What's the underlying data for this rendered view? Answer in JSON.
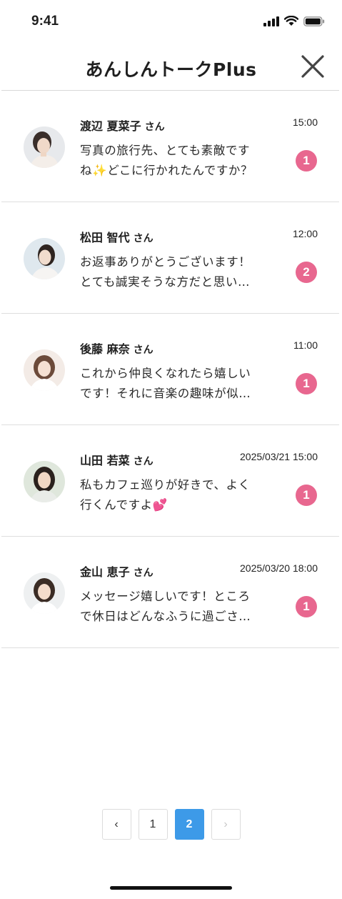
{
  "status_bar": {
    "time": "9:41"
  },
  "header": {
    "title": "あんしんトークPlus"
  },
  "messages": [
    {
      "name": "渡辺 夏菜子",
      "honorific": "さん",
      "time": "15:00",
      "preview_line1": "写真の旅行先、とても素敵です",
      "preview_line2": "ね✨どこに行かれたんですか？",
      "unread": "1"
    },
    {
      "name": "松田 智代",
      "honorific": "さん",
      "time": "12:00",
      "preview_line1": "お返事ありがとうございます！",
      "preview_line2": "とても誠実そうな方だと思い…",
      "unread": "2"
    },
    {
      "name": "後藤 麻奈",
      "honorific": "さん",
      "time": "11:00",
      "preview_line1": "これから仲良くなれたら嬉しい",
      "preview_line2": "です！それに音楽の趣味が似…",
      "unread": "1"
    },
    {
      "name": "山田 若菜",
      "honorific": "さん",
      "time": "2025/03/21 15:00",
      "preview_line1": "私もカフェ巡りが好きで、よく",
      "preview_line2": "行くんですよ💕",
      "unread": "1"
    },
    {
      "name": "金山 恵子",
      "honorific": "さん",
      "time": "2025/03/20 18:00",
      "preview_line1": "メッセージ嬉しいです！ところ",
      "preview_line2": "で休日はどんなふうに過ごさ…",
      "unread": "1"
    }
  ],
  "pagination": {
    "prev": "‹",
    "pages": [
      "1",
      "2"
    ],
    "current": "2",
    "next": "›"
  },
  "icons": {
    "close": "close-icon",
    "signal": "cellular-signal-icon",
    "wifi": "wifi-icon",
    "battery": "battery-icon"
  },
  "colors": {
    "unread_badge": "#e8678f",
    "active_page": "#3d9ae8"
  }
}
